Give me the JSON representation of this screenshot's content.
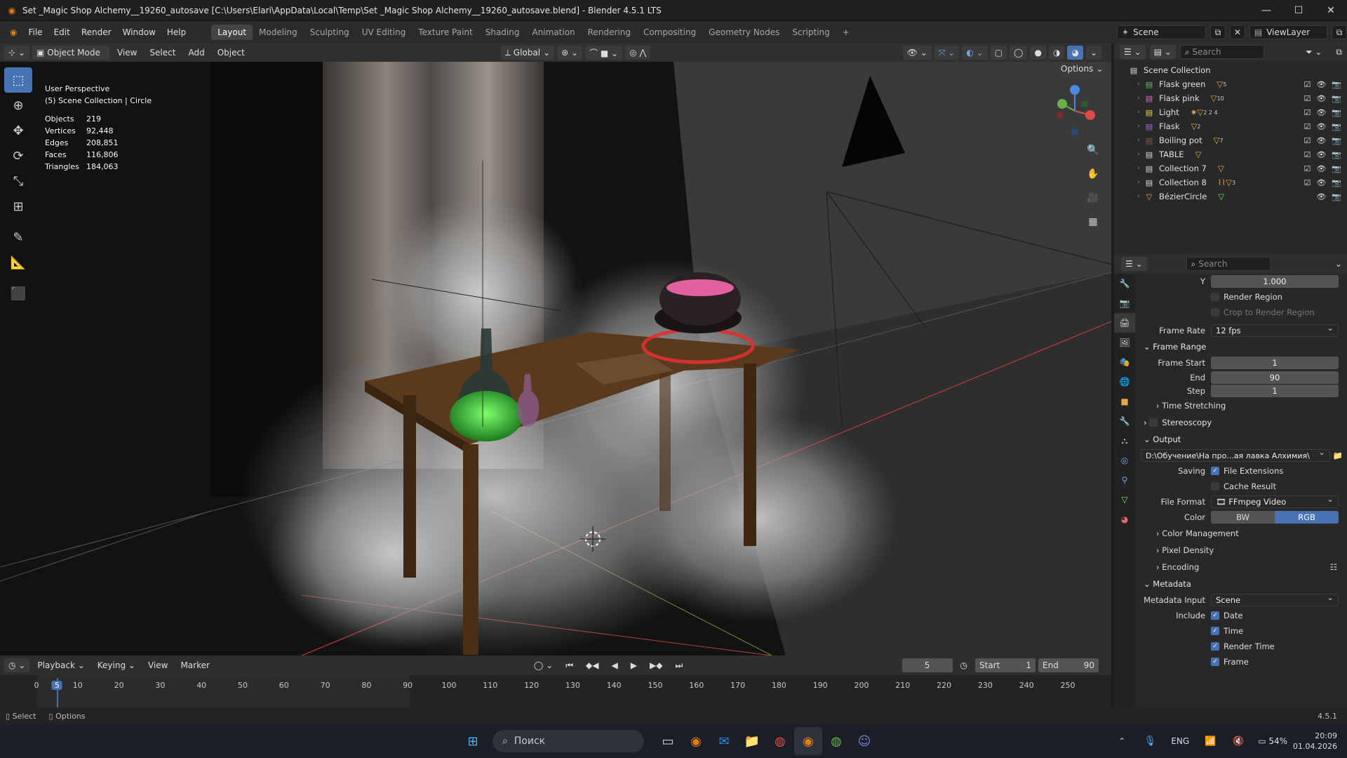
{
  "window": {
    "title": "Set _Magic Shop Alchemy__19260_autosave [C:\\Users\\Elari\\AppData\\Local\\Temp\\Set _Magic Shop Alchemy__19260_autosave.blend] - Blender 4.5.1 LTS"
  },
  "menu": [
    "File",
    "Edit",
    "Render",
    "Window",
    "Help"
  ],
  "workspaces": [
    "Layout",
    "Modeling",
    "Sculpting",
    "UV Editing",
    "Texture Paint",
    "Shading",
    "Animation",
    "Rendering",
    "Compositing",
    "Geometry Nodes",
    "Scripting"
  ],
  "active_workspace": "Layout",
  "scene": "Scene",
  "view_layer": "ViewLayer",
  "viewport_header": {
    "mode": "Object Mode",
    "menus": [
      "View",
      "Select",
      "Add",
      "Object"
    ],
    "transform": "Global",
    "options": "Options"
  },
  "overlay": {
    "perspective": "User Perspective",
    "collection": "(5) Scene Collection | Circle",
    "stats": [
      {
        "k": "Objects",
        "v": "219"
      },
      {
        "k": "Vertices",
        "v": "92,448"
      },
      {
        "k": "Edges",
        "v": "208,851"
      },
      {
        "k": "Faces",
        "v": "116,806"
      },
      {
        "k": "Triangles",
        "v": "184,063"
      }
    ]
  },
  "outliner": {
    "search_placeholder": "Search",
    "root": "Scene Collection",
    "items": [
      {
        "name": "Flask green",
        "count": "5"
      },
      {
        "name": "Flask pink",
        "count": "10"
      },
      {
        "name": "Light",
        "count": "2  2  4"
      },
      {
        "name": "Flask",
        "count": "2"
      },
      {
        "name": "Boiling pot",
        "count": "7"
      },
      {
        "name": "TABLE",
        "count": ""
      },
      {
        "name": "Collection 7",
        "count": ""
      },
      {
        "name": "Collection 8",
        "count": "3"
      },
      {
        "name": "BézierCircle",
        "count": ""
      }
    ]
  },
  "properties": {
    "search_placeholder": "Search",
    "y_label": "Y",
    "y_value": "1.000",
    "render_region": "Render Region",
    "crop": "Crop to Render Region",
    "frame_rate_label": "Frame Rate",
    "frame_rate": "12 fps",
    "frame_range": "Frame Range",
    "frame_start_label": "Frame Start",
    "frame_start": "1",
    "end_label": "End",
    "end": "90",
    "step_label": "Step",
    "step": "1",
    "time_stretching": "Time Stretching",
    "stereoscopy": "Stereoscopy",
    "output": "Output",
    "output_path": "D:\\Обучение\\На про...ая лавка  Алхимия\\",
    "saving_label": "Saving",
    "file_extensions": "File Extensions",
    "cache_result": "Cache Result",
    "file_format_label": "File Format",
    "file_format": "FFmpeg Video",
    "color_label": "Color",
    "bw": "BW",
    "rgb": "RGB",
    "color_management": "Color Management",
    "pixel_density": "Pixel Density",
    "encoding": "Encoding",
    "metadata": "Metadata",
    "metadata_input_label": "Metadata Input",
    "metadata_input": "Scene",
    "include_label": "Include",
    "date": "Date",
    "time": "Time",
    "render_time": "Render Time",
    "frame": "Frame"
  },
  "timeline": {
    "menus": [
      "Playback",
      "Keying",
      "View",
      "Marker"
    ],
    "current": "5",
    "start_label": "Start",
    "start": "1",
    "end_label": "End",
    "end": "90",
    "ticks": [
      "0",
      "5",
      "10",
      "20",
      "30",
      "40",
      "50",
      "60",
      "70",
      "80",
      "90",
      "100",
      "110",
      "120",
      "130",
      "140",
      "150",
      "160",
      "170",
      "180",
      "190",
      "200",
      "210",
      "220",
      "230",
      "240",
      "250"
    ]
  },
  "statusbar": {
    "select": "Select",
    "options": "Options",
    "version": "4.5.1"
  },
  "taskbar": {
    "search": "Поиск",
    "lang": "ENG",
    "battery": "54%",
    "time": "20:09",
    "date": "01.04.2026"
  },
  "colors": {
    "accent": "#4772b3",
    "blender_orange": "#e87d0d"
  }
}
